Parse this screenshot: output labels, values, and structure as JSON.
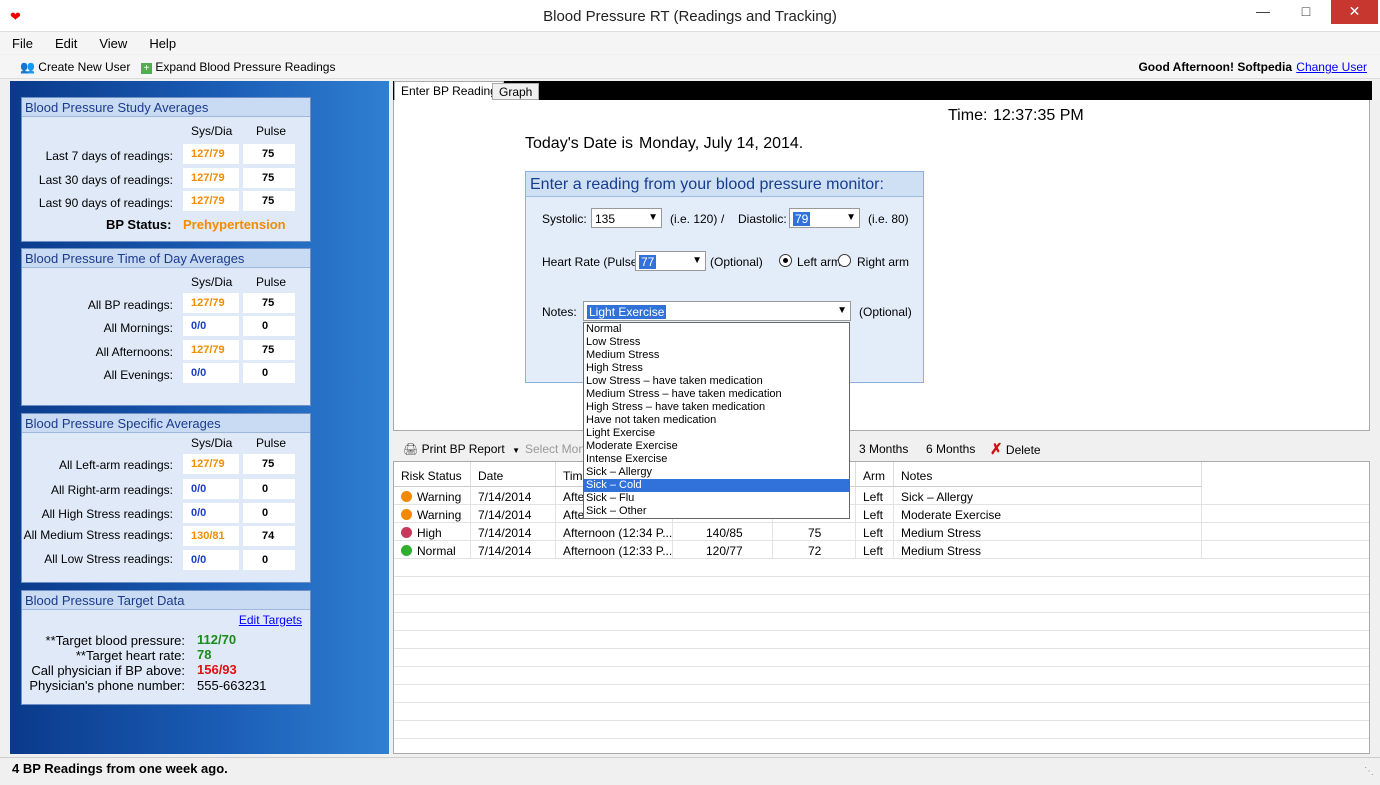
{
  "window": {
    "title": "Blood Pressure RT (Readings and Tracking)",
    "minimize": "—",
    "maximize": "□",
    "close": "✕",
    "app_icon": "heart-icon"
  },
  "menu": [
    "File",
    "Edit",
    "View",
    "Help"
  ],
  "toolbar": {
    "create_user": "Create New User",
    "expand": "Expand Blood Pressure Readings",
    "greeting": "Good Afternoon! Softpedia",
    "change_user": "Change User"
  },
  "study_averages": {
    "title": "Blood Pressure Study Averages",
    "col_sys": "Sys/Dia",
    "col_pulse": "Pulse",
    "rows": [
      {
        "label": "Last 7 days of readings:",
        "sys": "127/79",
        "pulse": "75"
      },
      {
        "label": "Last 30 days of readings:",
        "sys": "127/79",
        "pulse": "75"
      },
      {
        "label": "Last 90 days of readings:",
        "sys": "127/79",
        "pulse": "75"
      }
    ],
    "status_label": "BP Status:",
    "status_value": "Prehypertension"
  },
  "time_of_day": {
    "title": "Blood Pressure Time of Day Averages",
    "col_sys": "Sys/Dia",
    "col_pulse": "Pulse",
    "rows": [
      {
        "label": "All BP readings:",
        "sys": "127/79",
        "pulse": "75"
      },
      {
        "label": "All Mornings:",
        "sys": "0/0",
        "pulse": "0"
      },
      {
        "label": "All Afternoons:",
        "sys": "127/79",
        "pulse": "75"
      },
      {
        "label": "All Evenings:",
        "sys": "0/0",
        "pulse": "0"
      }
    ]
  },
  "specific": {
    "title": "Blood Pressure Specific Averages",
    "col_sys": "Sys/Dia",
    "col_pulse": "Pulse",
    "rows": [
      {
        "label": "All Left-arm readings:",
        "sys": "127/79",
        "pulse": "75"
      },
      {
        "label": "All Right-arm readings:",
        "sys": "0/0",
        "pulse": "0"
      },
      {
        "label": "All High Stress readings:",
        "sys": "0/0",
        "pulse": "0"
      },
      {
        "label": "All Medium Stress readings:",
        "sys": "130/81",
        "pulse": "74"
      },
      {
        "label": "All Low Stress readings:",
        "sys": "0/0",
        "pulse": "0"
      }
    ]
  },
  "target": {
    "title": "Blood Pressure Target Data",
    "edit": "Edit Targets",
    "rows": [
      {
        "label": "**Target blood pressure:",
        "value": "112/70",
        "color": "#1a8a1a"
      },
      {
        "label": "**Target heart rate:",
        "value": "78",
        "color": "#1a8a1a"
      },
      {
        "label": "Call physician if BP above:",
        "value": "156/93",
        "color": "#e01010"
      },
      {
        "label": "Physician's phone number:",
        "value": "555-663231",
        "color": "#000000"
      }
    ]
  },
  "tabs": [
    "Enter BP Reading",
    "Graph"
  ],
  "entry": {
    "time_label": "Time:",
    "time_value": "12:37:35 PM",
    "date_label": "Today's Date is",
    "date_value": "Monday, July 14, 2014.",
    "box_title": "Enter a reading from your blood pressure monitor:",
    "systolic_label": "Systolic:",
    "systolic_value": "135",
    "systolic_hint": "(i.e. 120)",
    "slash": "/",
    "diastolic_label": "Diastolic:",
    "diastolic_value": "79",
    "diastolic_hint": "(i.e. 80)",
    "hr_label": "Heart Rate (Pulse):",
    "hr_value": "77",
    "hr_hint": "(Optional)",
    "left_arm": "Left arm",
    "right_arm": "Right arm",
    "notes_label": "Notes:",
    "notes_value": "Light Exercise",
    "notes_hint": "(Optional)"
  },
  "notes_options": [
    "Normal",
    "Low Stress",
    "Medium Stress",
    "High Stress",
    "Low Stress – have taken medication",
    "Medium Stress – have taken medication",
    "High Stress – have taken medication",
    "Have not taken medication",
    "Light Exercise",
    "Moderate Exercise",
    "Intense Exercise",
    "Sick – Allergy",
    "Sick – Cold",
    "Sick – Flu",
    "Sick – Other"
  ],
  "readings_toolbar": {
    "print": "Print BP Report",
    "select_month": "Select Mon",
    "three_months": "3 Months",
    "six_months": "6 Months",
    "delete": "Delete"
  },
  "table": {
    "headers": [
      "Risk Status",
      "Date",
      "Time",
      "",
      "",
      "Arm",
      "Notes"
    ],
    "rows": [
      {
        "status": "Warning",
        "color": "#f08a00",
        "date": "7/14/2014",
        "time": "Afte",
        "bp": "",
        "pulse": "",
        "arm": "Left",
        "notes": "Sick – Allergy"
      },
      {
        "status": "Warning",
        "color": "#f08a00",
        "date": "7/14/2014",
        "time": "Afte",
        "bp": "",
        "pulse": "",
        "arm": "Left",
        "notes": "Moderate Exercise"
      },
      {
        "status": "High",
        "color": "#c8385a",
        "date": "7/14/2014",
        "time": "Afternoon (12:34 P...",
        "bp": "140/85",
        "pulse": "75",
        "arm": "Left",
        "notes": "Medium Stress"
      },
      {
        "status": "Normal",
        "color": "#2fae2f",
        "date": "7/14/2014",
        "time": "Afternoon (12:33 P...",
        "bp": "120/77",
        "pulse": "72",
        "arm": "Left",
        "notes": "Medium Stress"
      }
    ]
  },
  "status_bar": "4 BP Readings from one week ago."
}
